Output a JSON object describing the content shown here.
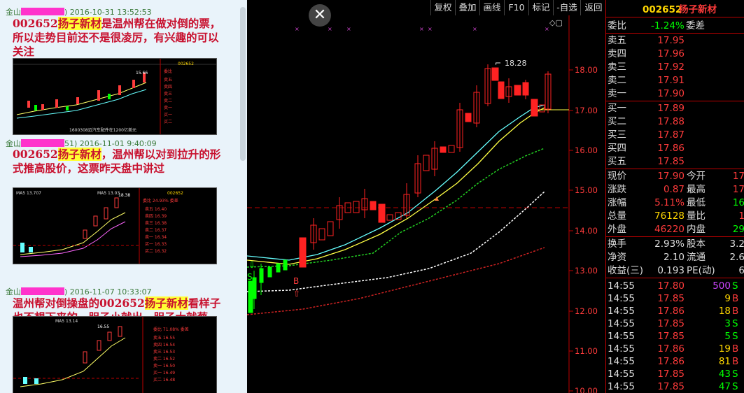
{
  "chat": {
    "messages": [
      {
        "sender": "金山",
        "sender_tail": ")",
        "time": "2016-10-31 13:52:53",
        "code": "002652",
        "name": "扬子新材",
        "text": "是温州帮在做对倒的票，所以走势目前还不是很凌厉，有兴趣的可以关注"
      },
      {
        "sender": "金山",
        "sender_tail": "51)",
        "time": "2016-11-01 9:40:09",
        "code": "002652",
        "name": "扬子新材",
        "text": "，温州帮以对到拉升的形式推高股价，这票昨天盘中讲过"
      },
      {
        "sender": "金山",
        "sender_tail": ")",
        "time": "2016-11-07 10:33:07",
        "prefix": "温州帮对倒操盘的",
        "code": "002652",
        "name": "扬子新材",
        "text": "看样子也不想下来的，胆子小就出，胆子大就蔡"
      }
    ],
    "thumb1": {
      "code": "002652",
      "name": "扬子新材",
      "price_label": "15.66",
      "footer": "1600308迈汽车配件在1200亿美元"
    },
    "thumb2": {
      "code": "002652",
      "name": "扬子新材",
      "ma": "MA5 13.707",
      "ma2": "MA5 13.03",
      "peak": "18.38",
      "ratio": "委比 24.93% 委差"
    },
    "thumb3": {
      "code": "002652",
      "name": "扬子新材",
      "ma": "MA5 13.14",
      "peak": "16.55",
      "ratio": "委比 71.08% 委差"
    }
  },
  "toolbar": {
    "buttons": [
      "复权",
      "叠加",
      "画线",
      "F10",
      "标记",
      "-自选",
      "返回"
    ]
  },
  "chart": {
    "high_label": "18.28",
    "price_axis": [
      "18.00",
      "17.00",
      "16.00",
      "15.00",
      "14.00",
      "13.00",
      "12.00",
      "11.00",
      "10.00"
    ],
    "signal_s": "S",
    "signal_b": "B"
  },
  "quote": {
    "code": "002652",
    "name": "扬子新材",
    "weibi_label": "委比",
    "weibi_value": "-1.24%",
    "weicha_label": "委差",
    "sells": [
      {
        "label": "卖五",
        "price": "17.95"
      },
      {
        "label": "卖四",
        "price": "17.96"
      },
      {
        "label": "卖三",
        "price": "17.92"
      },
      {
        "label": "卖二",
        "price": "17.91"
      },
      {
        "label": "卖一",
        "price": "17.90"
      }
    ],
    "buys": [
      {
        "label": "买一",
        "price": "17.89"
      },
      {
        "label": "买二",
        "price": "17.88"
      },
      {
        "label": "买三",
        "price": "17.87"
      },
      {
        "label": "买四",
        "price": "17.86"
      },
      {
        "label": "买五",
        "price": "17.85"
      }
    ],
    "stats": [
      {
        "l1": "现价",
        "v1": "17.90",
        "l2": "今开",
        "v2": "17"
      },
      {
        "l1": "涨跌",
        "v1": "0.87",
        "l2": "最高",
        "v2": "17"
      },
      {
        "l1": "涨幅",
        "v1": "5.11%",
        "l2": "最低",
        "v2": "16"
      },
      {
        "l1": "总量",
        "v1": "76128",
        "l2": "量比",
        "v2": "1"
      },
      {
        "l1": "外盘",
        "v1": "46220",
        "l2": "内盘",
        "v2": "29"
      }
    ],
    "stats2": [
      {
        "l1": "换手",
        "v1": "2.93%",
        "l2": "股本",
        "v2": "3.2"
      },
      {
        "l1": "净资",
        "v1": "2.10",
        "l2": "流通",
        "v2": "2.6"
      },
      {
        "l1": "收益(三)",
        "v1": "0.193",
        "l2": "PE(动)",
        "v2": "6"
      }
    ],
    "ticks": [
      {
        "time": "14:55",
        "price": "17.80",
        "vol": "500",
        "side": "S"
      },
      {
        "time": "14:55",
        "price": "17.85",
        "vol": "9",
        "side": "B"
      },
      {
        "time": "14:55",
        "price": "17.86",
        "vol": "18",
        "side": "B"
      },
      {
        "time": "14:55",
        "price": "17.85",
        "vol": "3",
        "side": "S"
      },
      {
        "time": "14:55",
        "price": "17.85",
        "vol": "5",
        "side": "S"
      },
      {
        "time": "14:55",
        "price": "17.86",
        "vol": "19",
        "side": "B"
      },
      {
        "time": "14:55",
        "price": "17.86",
        "vol": "81",
        "side": "B"
      },
      {
        "time": "14:55",
        "price": "17.85",
        "vol": "43",
        "side": "S"
      },
      {
        "time": "14:55",
        "price": "17.85",
        "vol": "47",
        "side": "S"
      }
    ]
  },
  "colors": {
    "up": "#ff3b3b",
    "down": "#00ff00",
    "accent": "#ffd700",
    "panel_border": "#b00000"
  }
}
